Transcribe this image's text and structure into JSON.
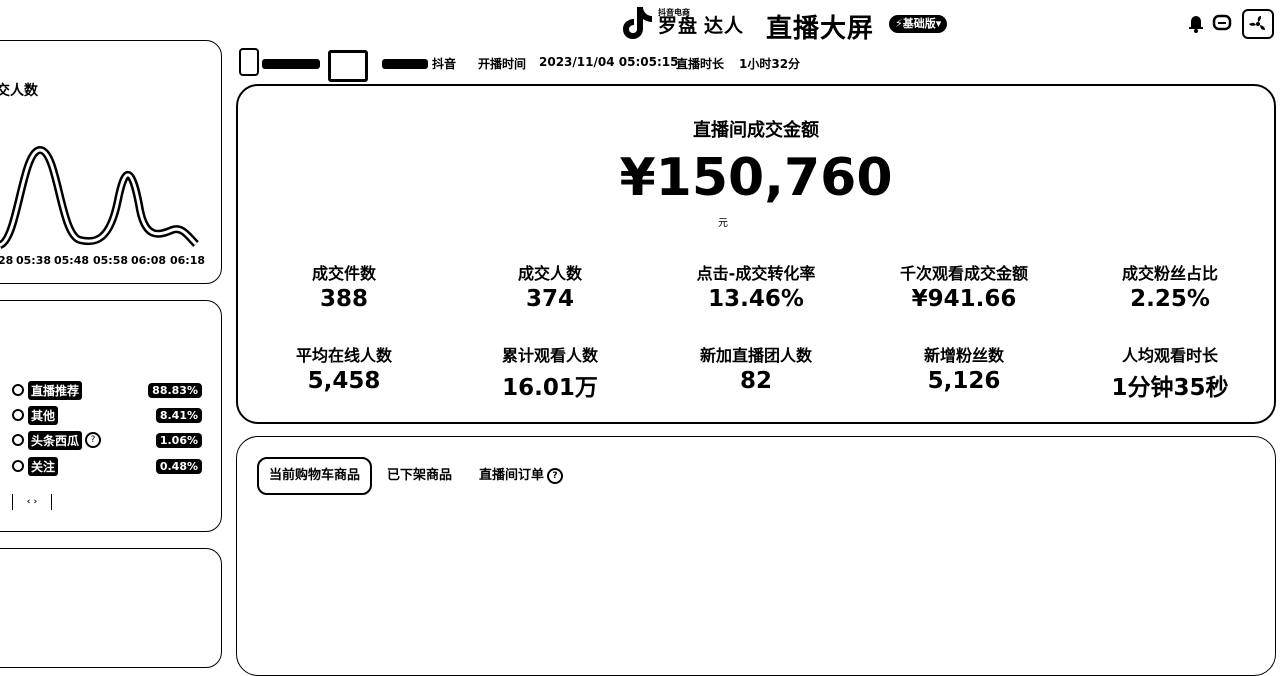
{
  "header": {
    "brand_small": "抖音电商",
    "brand_a": "罗盘",
    "brand_b": "达人",
    "title": "直播大屏",
    "edition": "⚡基础版▾"
  },
  "live_info": {
    "platform": "抖音",
    "start_label": "开播时间",
    "start_value": "2023/11/04 05:05:15",
    "duration_label": "直播时长",
    "duration_value": "1小时32分"
  },
  "left_chart": {
    "title_partial": "交人数",
    "x_ticks": [
      "28",
      "05:38",
      "05:48",
      "05:58",
      "06:08",
      "06:18"
    ]
  },
  "traffic_sources": [
    {
      "label": "直播推荐",
      "pct": "88.83%",
      "help": false
    },
    {
      "label": "其他",
      "pct": "8.41%",
      "help": false
    },
    {
      "label": "头条西瓜",
      "pct": "1.06%",
      "help": true
    },
    {
      "label": "关注",
      "pct": "0.48%",
      "help": false
    }
  ],
  "gmv": {
    "title": "直播间成交金额",
    "value": "¥150,760",
    "note": "元"
  },
  "metrics_row1": [
    {
      "label": "成交件数",
      "value": "388"
    },
    {
      "label": "成交人数",
      "value": "374"
    },
    {
      "label": "点击-成交转化率",
      "value": "13.46%"
    },
    {
      "label": "千次观看成交金额",
      "value": "¥941.66"
    },
    {
      "label": "成交粉丝占比",
      "value": "2.25%"
    }
  ],
  "metrics_row2": [
    {
      "label": "平均在线人数",
      "value": "5,458"
    },
    {
      "label": "累计观看人数",
      "value": "16.01万"
    },
    {
      "label": "新加直播团人数",
      "value": "82"
    },
    {
      "label": "新增粉丝数",
      "value": "5,126"
    },
    {
      "label": "人均观看时长",
      "value": "1分钟35秒"
    }
  ],
  "product_tabs": {
    "current": "当前购物车商品",
    "removed": "已下架商品",
    "orders": "直播间订单"
  },
  "colors": {
    "ink": "#000000",
    "background": "#ffffff"
  }
}
